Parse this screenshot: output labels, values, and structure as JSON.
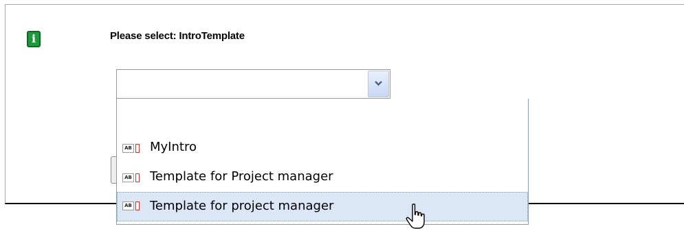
{
  "dialog": {
    "prompt": "Please select: IntroTemplate",
    "info_icon": "info-icon"
  },
  "combo": {
    "value": "",
    "arrow_icon": "chevron-down-icon"
  },
  "dropdown": {
    "options": [
      {
        "label": "",
        "icon": ""
      },
      {
        "label": "MyIntro",
        "icon": "text-template-icon",
        "icon_text": "AB"
      },
      {
        "label": "Template for Project manager",
        "icon": "text-template-icon",
        "icon_text": "AB"
      },
      {
        "label": "Template for project manager",
        "icon": "text-template-icon",
        "icon_text": "AB",
        "hovered": true
      }
    ]
  },
  "cursor": "hand-pointer-icon"
}
